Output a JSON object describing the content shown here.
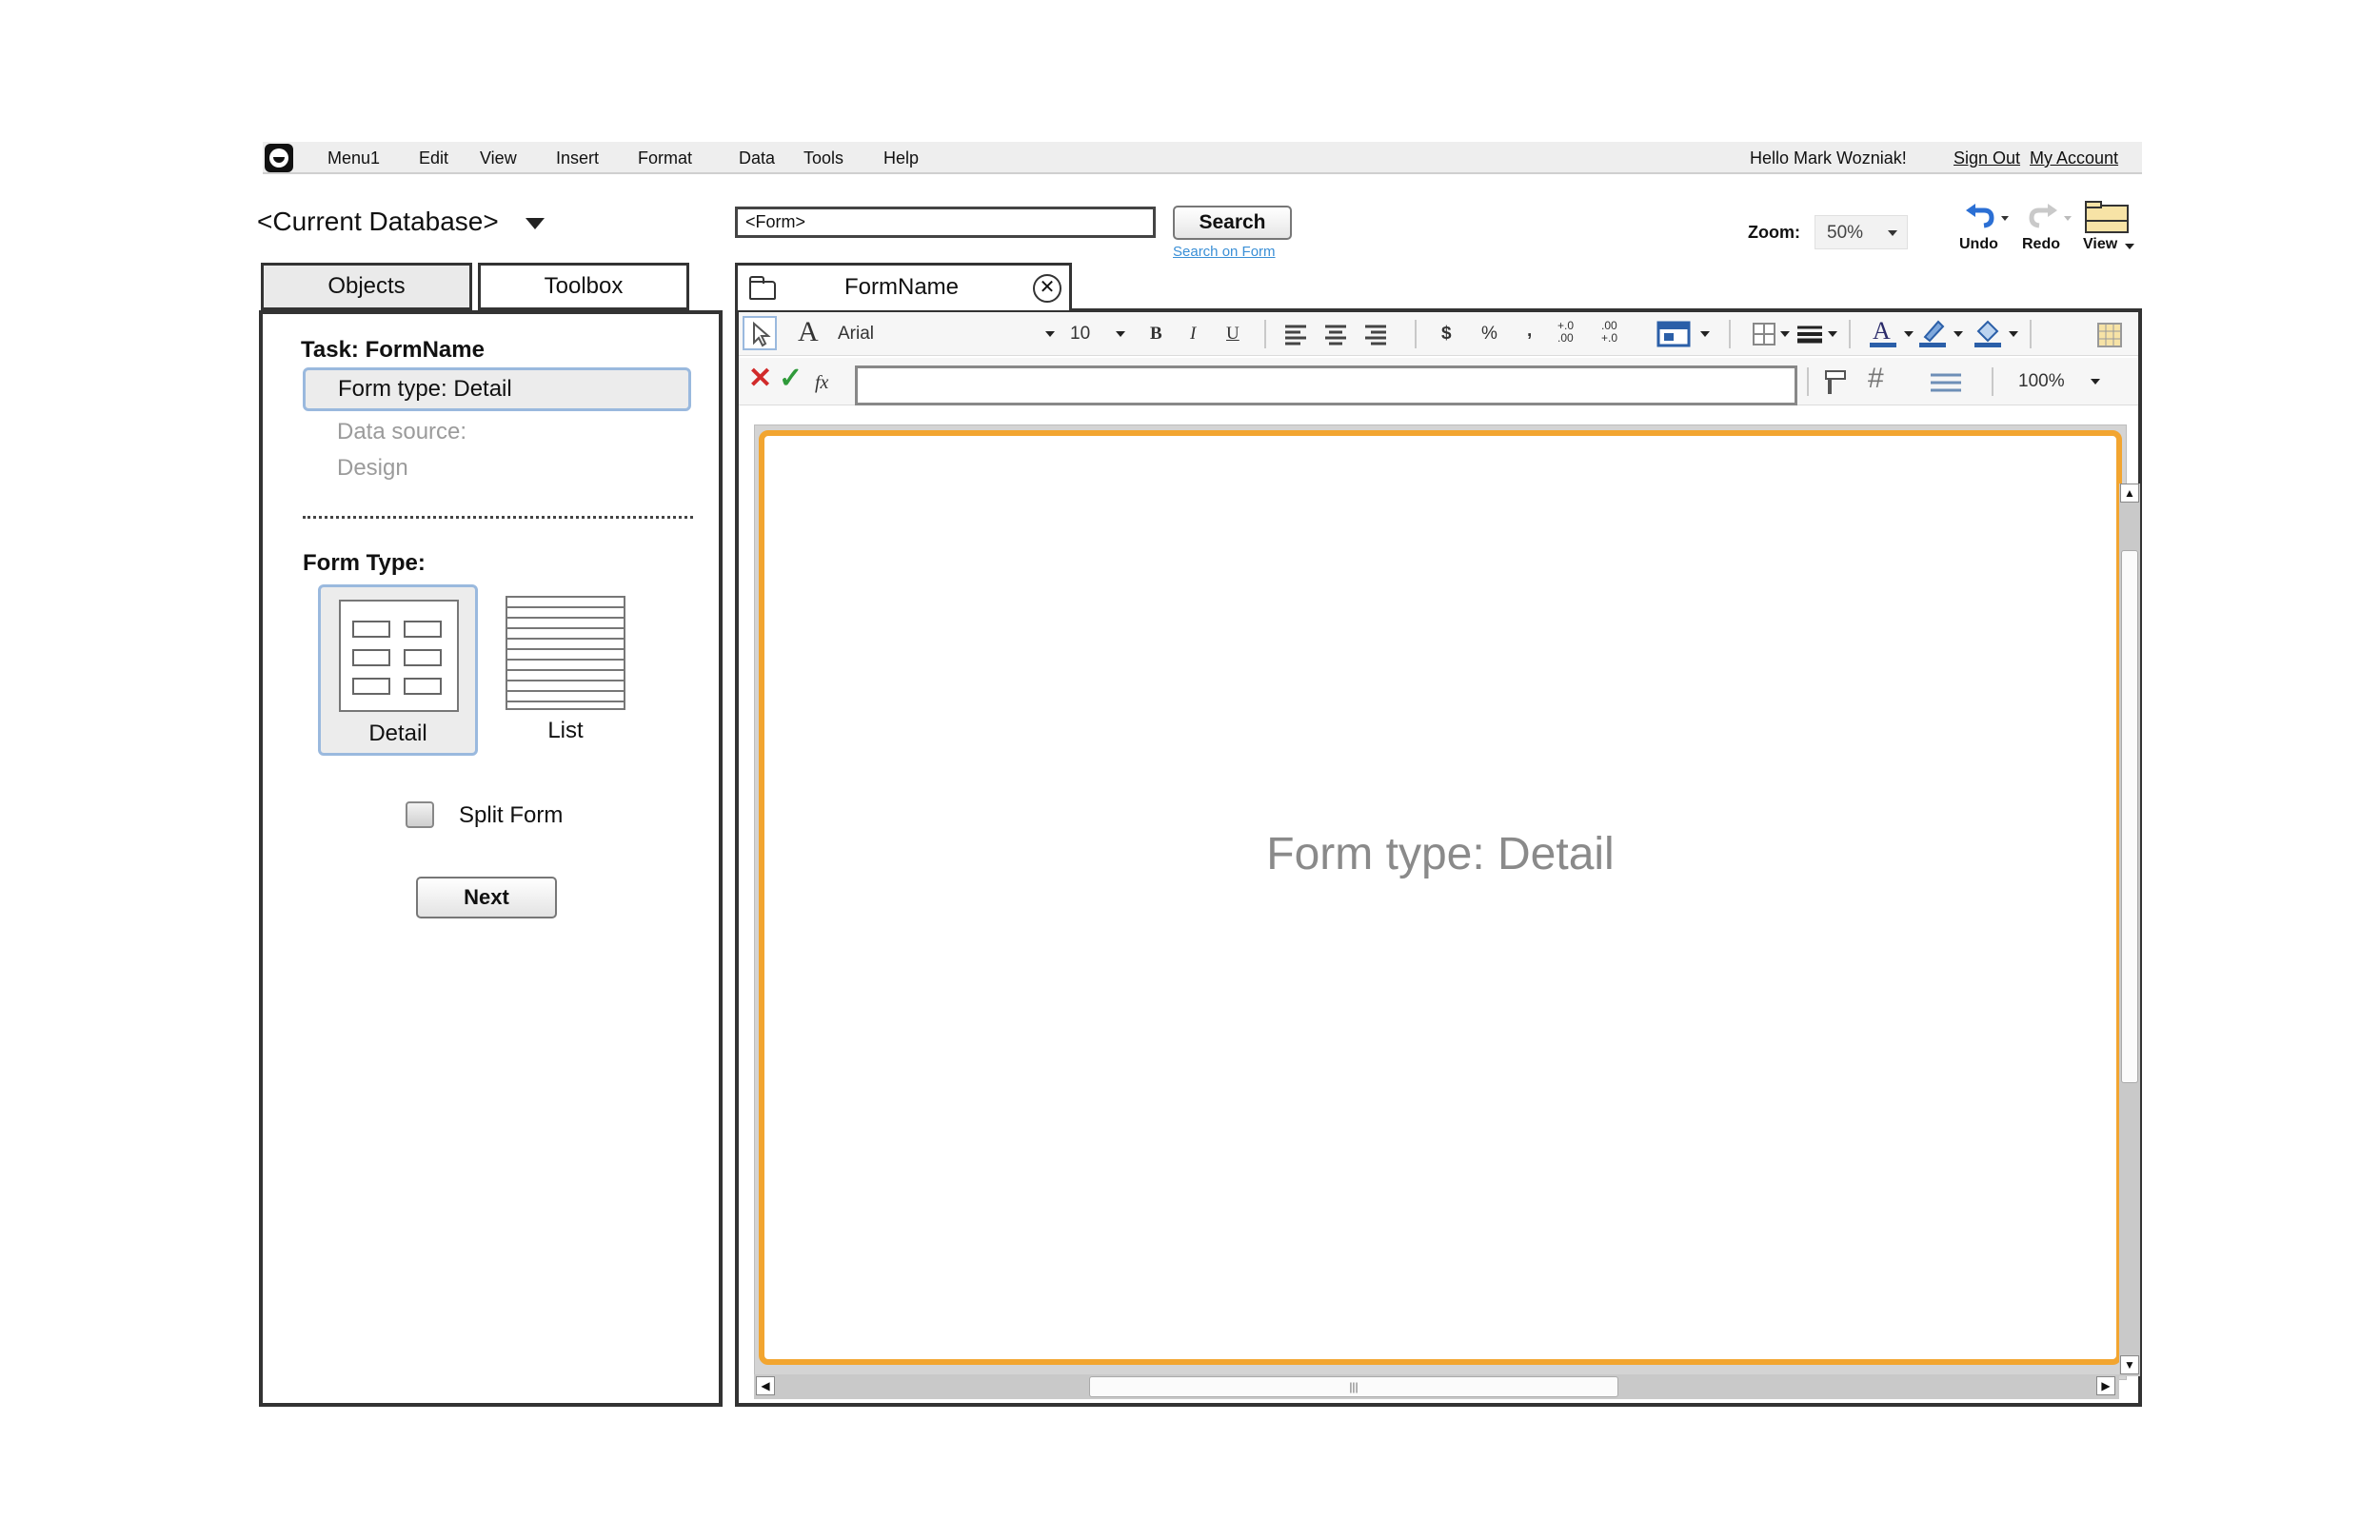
{
  "menubar": {
    "items": [
      "Menu1",
      "Edit",
      "View",
      "Insert",
      "Format",
      "Data",
      "Tools",
      "Help"
    ],
    "greeting": "Hello  Mark Wozniak!",
    "sign_out": "Sign Out",
    "my_account": "My Account"
  },
  "database": {
    "current": "<Current Database>"
  },
  "form_field": {
    "value": "<Form>"
  },
  "search": {
    "button": "Search",
    "link": "Search on Form"
  },
  "zoom": {
    "label": "Zoom:",
    "value": "50%"
  },
  "history": {
    "undo": "Undo",
    "redo": "Redo",
    "view": "View"
  },
  "left_tabs": {
    "objects": "Objects",
    "toolbox": "Toolbox"
  },
  "task": {
    "title": "Task: FormName",
    "steps": [
      "Form type: Detail",
      "Data source:",
      "Design"
    ]
  },
  "form_type": {
    "title": "Form Type:",
    "options": [
      "Detail",
      "List"
    ],
    "selected": "Detail"
  },
  "split_form": {
    "label": "Split Form",
    "checked": false
  },
  "next_button": "Next",
  "form_tab": {
    "label": "FormName"
  },
  "toolbar": {
    "font": "Arial",
    "size": "10",
    "bold": "B",
    "italic": "I",
    "underline": "U",
    "currency": "$",
    "percent": "%",
    "comma": ",",
    "inc_decimal": "+.0 .00",
    "dec_decimal": ".00 +.0",
    "fx": "fx",
    "zoom2": "100%"
  },
  "canvas": {
    "label": "Form type: Detail"
  },
  "colors": {
    "accent": "#f2a530",
    "selection": "#9ab9de",
    "link": "#3a8fd6"
  }
}
